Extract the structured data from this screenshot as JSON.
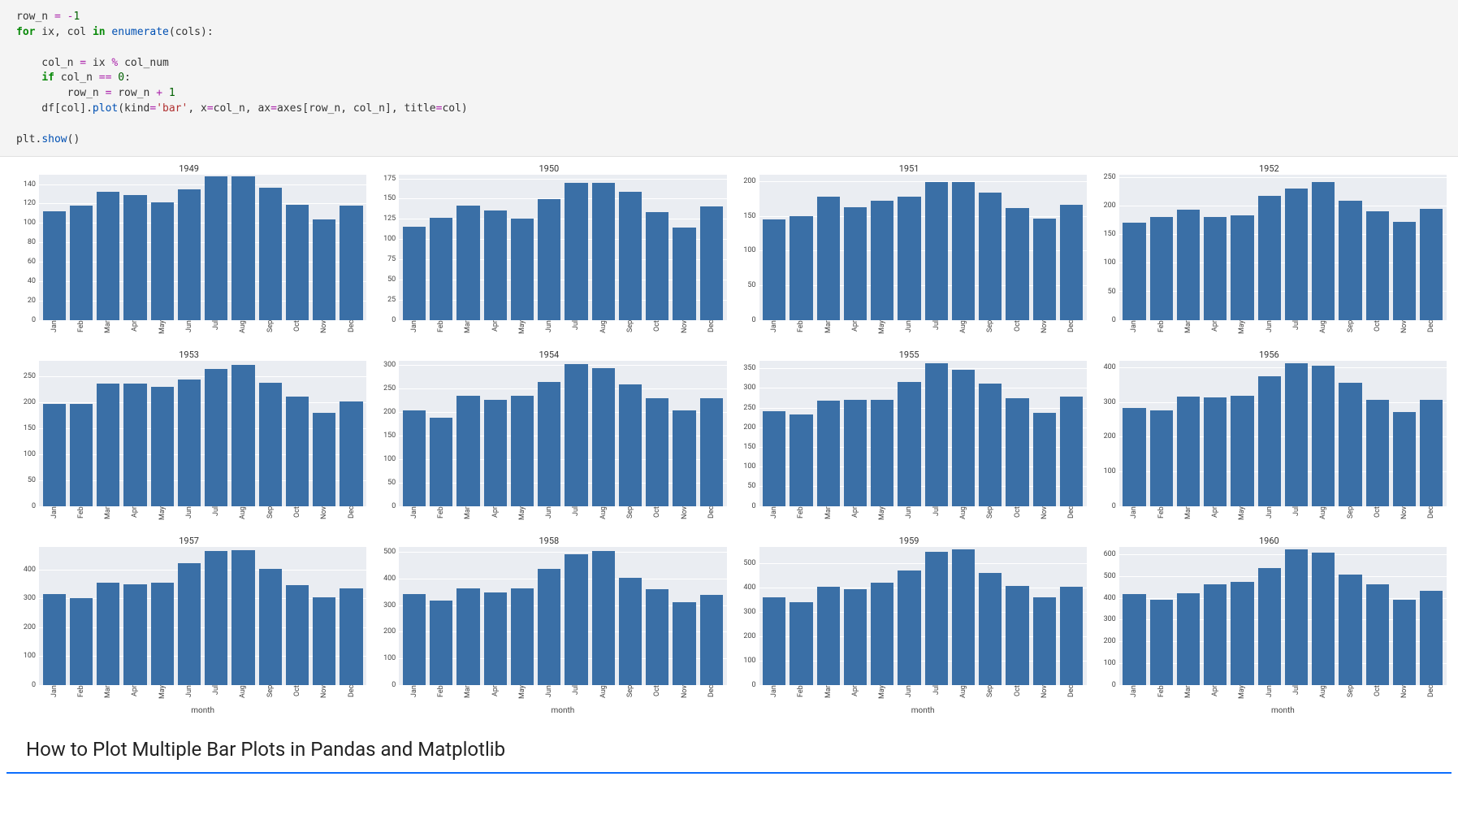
{
  "code": {
    "lines": [
      {
        "segments": [
          {
            "t": "row_n ",
            "c": ""
          },
          {
            "t": "=",
            "c": "op"
          },
          {
            "t": " ",
            "c": ""
          },
          {
            "t": "-",
            "c": "op"
          },
          {
            "t": "1",
            "c": "num"
          }
        ]
      },
      {
        "segments": [
          {
            "t": "for",
            "c": "kw"
          },
          {
            "t": " ix, col ",
            "c": ""
          },
          {
            "t": "in",
            "c": "kw"
          },
          {
            "t": " ",
            "c": ""
          },
          {
            "t": "enumerate",
            "c": "fn"
          },
          {
            "t": "(cols):",
            "c": ""
          }
        ]
      },
      {
        "segments": [
          {
            "t": "",
            "c": ""
          }
        ]
      },
      {
        "segments": [
          {
            "t": "    col_n ",
            "c": ""
          },
          {
            "t": "=",
            "c": "op"
          },
          {
            "t": " ix ",
            "c": ""
          },
          {
            "t": "%",
            "c": "op"
          },
          {
            "t": " col_num",
            "c": ""
          }
        ]
      },
      {
        "segments": [
          {
            "t": "    ",
            "c": ""
          },
          {
            "t": "if",
            "c": "kw"
          },
          {
            "t": " col_n ",
            "c": ""
          },
          {
            "t": "==",
            "c": "op"
          },
          {
            "t": " ",
            "c": ""
          },
          {
            "t": "0",
            "c": "num"
          },
          {
            "t": ":",
            "c": ""
          }
        ]
      },
      {
        "segments": [
          {
            "t": "        row_n ",
            "c": ""
          },
          {
            "t": "=",
            "c": "op"
          },
          {
            "t": " row_n ",
            "c": ""
          },
          {
            "t": "+",
            "c": "op"
          },
          {
            "t": " ",
            "c": ""
          },
          {
            "t": "1",
            "c": "num"
          }
        ]
      },
      {
        "segments": [
          {
            "t": "    df[col].",
            "c": ""
          },
          {
            "t": "plot",
            "c": "fn"
          },
          {
            "t": "(kind",
            "c": ""
          },
          {
            "t": "=",
            "c": "op"
          },
          {
            "t": "'bar'",
            "c": "str"
          },
          {
            "t": ", x",
            "c": ""
          },
          {
            "t": "=",
            "c": "op"
          },
          {
            "t": "col_n, ax",
            "c": ""
          },
          {
            "t": "=",
            "c": "op"
          },
          {
            "t": "axes[row_n, col_n], title",
            "c": ""
          },
          {
            "t": "=",
            "c": "op"
          },
          {
            "t": "col)",
            "c": ""
          }
        ]
      },
      {
        "segments": [
          {
            "t": "",
            "c": ""
          }
        ]
      },
      {
        "segments": [
          {
            "t": "plt.",
            "c": ""
          },
          {
            "t": "show",
            "c": "fn"
          },
          {
            "t": "()",
            "c": ""
          }
        ]
      }
    ]
  },
  "heading": "How to Plot Multiple Bar Plots in Pandas and Matplotlib",
  "chart_data": [
    {
      "type": "bar",
      "title": "1949",
      "categories": [
        "Jan",
        "Feb",
        "Mar",
        "Apr",
        "May",
        "Jun",
        "Jul",
        "Aug",
        "Sep",
        "Oct",
        "Nov",
        "Dec"
      ],
      "values": [
        112,
        118,
        132,
        129,
        121,
        135,
        148,
        148,
        136,
        119,
        104,
        118
      ],
      "y_ticks": [
        0,
        20,
        40,
        60,
        80,
        100,
        120,
        140
      ],
      "ylim": [
        0,
        150
      ],
      "show_x_title": false
    },
    {
      "type": "bar",
      "title": "1950",
      "categories": [
        "Jan",
        "Feb",
        "Mar",
        "Apr",
        "May",
        "Jun",
        "Jul",
        "Aug",
        "Sep",
        "Oct",
        "Nov",
        "Dec"
      ],
      "values": [
        115,
        126,
        141,
        135,
        125,
        149,
        170,
        170,
        158,
        133,
        114,
        140
      ],
      "y_ticks": [
        0,
        25,
        50,
        75,
        100,
        125,
        150,
        175
      ],
      "ylim": [
        0,
        180
      ],
      "show_x_title": false
    },
    {
      "type": "bar",
      "title": "1951",
      "categories": [
        "Jan",
        "Feb",
        "Mar",
        "Apr",
        "May",
        "Jun",
        "Jul",
        "Aug",
        "Sep",
        "Oct",
        "Nov",
        "Dec"
      ],
      "values": [
        145,
        150,
        178,
        163,
        172,
        178,
        199,
        199,
        184,
        162,
        146,
        166
      ],
      "y_ticks": [
        0,
        50,
        100,
        150,
        200
      ],
      "ylim": [
        0,
        210
      ],
      "show_x_title": false
    },
    {
      "type": "bar",
      "title": "1952",
      "categories": [
        "Jan",
        "Feb",
        "Mar",
        "Apr",
        "May",
        "Jun",
        "Jul",
        "Aug",
        "Sep",
        "Oct",
        "Nov",
        "Dec"
      ],
      "values": [
        171,
        180,
        193,
        181,
        183,
        218,
        230,
        242,
        209,
        191,
        172,
        194
      ],
      "y_ticks": [
        0,
        50,
        100,
        150,
        200,
        250
      ],
      "ylim": [
        0,
        255
      ],
      "show_x_title": false
    },
    {
      "type": "bar",
      "title": "1953",
      "categories": [
        "Jan",
        "Feb",
        "Mar",
        "Apr",
        "May",
        "Jun",
        "Jul",
        "Aug",
        "Sep",
        "Oct",
        "Nov",
        "Dec"
      ],
      "values": [
        196,
        196,
        236,
        235,
        229,
        243,
        264,
        272,
        237,
        211,
        180,
        201
      ],
      "y_ticks": [
        0,
        50,
        100,
        150,
        200,
        250
      ],
      "ylim": [
        0,
        280
      ],
      "show_x_title": false
    },
    {
      "type": "bar",
      "title": "1954",
      "categories": [
        "Jan",
        "Feb",
        "Mar",
        "Apr",
        "May",
        "Jun",
        "Jul",
        "Aug",
        "Sep",
        "Oct",
        "Nov",
        "Dec"
      ],
      "values": [
        204,
        188,
        235,
        227,
        234,
        264,
        302,
        293,
        259,
        229,
        203,
        229
      ],
      "y_ticks": [
        0,
        50,
        100,
        150,
        200,
        250,
        300
      ],
      "ylim": [
        0,
        310
      ],
      "show_x_title": false
    },
    {
      "type": "bar",
      "title": "1955",
      "categories": [
        "Jan",
        "Feb",
        "Mar",
        "Apr",
        "May",
        "Jun",
        "Jul",
        "Aug",
        "Sep",
        "Oct",
        "Nov",
        "Dec"
      ],
      "values": [
        242,
        233,
        267,
        269,
        270,
        315,
        364,
        347,
        312,
        274,
        237,
        278
      ],
      "y_ticks": [
        0,
        50,
        100,
        150,
        200,
        250,
        300,
        350
      ],
      "ylim": [
        0,
        370
      ],
      "show_x_title": false
    },
    {
      "type": "bar",
      "title": "1956",
      "categories": [
        "Jan",
        "Feb",
        "Mar",
        "Apr",
        "May",
        "Jun",
        "Jul",
        "Aug",
        "Sep",
        "Oct",
        "Nov",
        "Dec"
      ],
      "values": [
        284,
        277,
        317,
        313,
        318,
        374,
        413,
        405,
        355,
        306,
        271,
        306
      ],
      "y_ticks": [
        0,
        100,
        200,
        300,
        400
      ],
      "ylim": [
        0,
        420
      ],
      "show_x_title": false
    },
    {
      "type": "bar",
      "title": "1957",
      "categories": [
        "Jan",
        "Feb",
        "Mar",
        "Apr",
        "May",
        "Jun",
        "Jul",
        "Aug",
        "Sep",
        "Oct",
        "Nov",
        "Dec"
      ],
      "values": [
        315,
        301,
        356,
        348,
        355,
        422,
        465,
        467,
        404,
        347,
        305,
        336
      ],
      "y_ticks": [
        0,
        100,
        200,
        300,
        400
      ],
      "ylim": [
        0,
        480
      ],
      "show_x_title": true
    },
    {
      "type": "bar",
      "title": "1958",
      "categories": [
        "Jan",
        "Feb",
        "Mar",
        "Apr",
        "May",
        "Jun",
        "Jul",
        "Aug",
        "Sep",
        "Oct",
        "Nov",
        "Dec"
      ],
      "values": [
        340,
        318,
        362,
        348,
        363,
        435,
        491,
        505,
        404,
        359,
        310,
        337
      ],
      "y_ticks": [
        0,
        100,
        200,
        300,
        400,
        500
      ],
      "ylim": [
        0,
        520
      ],
      "show_x_title": true
    },
    {
      "type": "bar",
      "title": "1959",
      "categories": [
        "Jan",
        "Feb",
        "Mar",
        "Apr",
        "May",
        "Jun",
        "Jul",
        "Aug",
        "Sep",
        "Oct",
        "Nov",
        "Dec"
      ],
      "values": [
        360,
        342,
        406,
        396,
        420,
        472,
        548,
        559,
        463,
        407,
        362,
        405
      ],
      "y_ticks": [
        0,
        100,
        200,
        300,
        400,
        500
      ],
      "ylim": [
        0,
        570
      ],
      "show_x_title": true
    },
    {
      "type": "bar",
      "title": "1960",
      "categories": [
        "Jan",
        "Feb",
        "Mar",
        "Apr",
        "May",
        "Jun",
        "Jul",
        "Aug",
        "Sep",
        "Oct",
        "Nov",
        "Dec"
      ],
      "values": [
        417,
        391,
        419,
        461,
        472,
        535,
        622,
        606,
        508,
        461,
        390,
        432
      ],
      "y_ticks": [
        0,
        100,
        200,
        300,
        400,
        500,
        600
      ],
      "ylim": [
        0,
        635
      ],
      "show_x_title": true
    }
  ],
  "x_axis_title": "month",
  "bar_color": "#3a6fa6",
  "plot_background": "#eaedf2"
}
